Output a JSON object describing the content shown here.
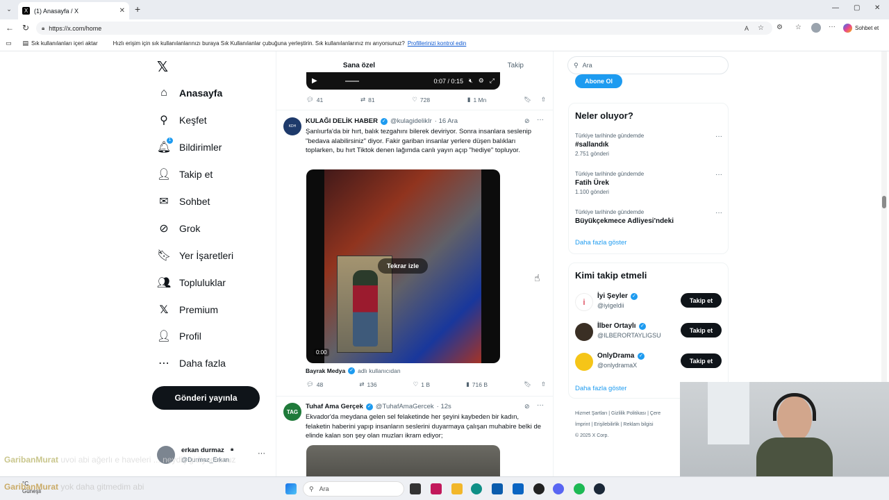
{
  "browser": {
    "tab_title": "(1) Anasayfa / X",
    "url": "https://x.com/home",
    "copilot_label": "Sohbet et",
    "import_label": "Sık kullanılanları içeri aktar",
    "fav_hint": "Hızlı erişim için sık kullanılanlarınızı buraya Sık Kullanılanlar çubuğuna yerleştirin. Sık kullanılanlarınız mı arıyorsunuz?",
    "fav_link": "Profillerinizi kontrol edin"
  },
  "nav": {
    "home": "Anasayfa",
    "explore": "Keşfet",
    "notifications": "Bildirimler",
    "follow": "Takip et",
    "chat": "Sohbet",
    "grok": "Grok",
    "bookmarks": "Yer İşaretleri",
    "communities": "Topluluklar",
    "premium": "Premium",
    "profile": "Profil",
    "more": "Daha fazla",
    "post_button": "Gönderi yayınla",
    "notif_count": "1"
  },
  "account": {
    "name": "erkan durmaz",
    "handle": "@Durmaz_Erkan"
  },
  "feed": {
    "tab_for_you": "Sana özel",
    "tab_following": "Takip",
    "top_video_time": "0:07 / 0:15",
    "top_stats": {
      "replies": "41",
      "reposts": "81",
      "likes": "728",
      "views": "1 Mn"
    },
    "post1": {
      "name": "KULAĞI DELİK HABER",
      "handle": "@kulagidelikIr",
      "time": "· 16 Ara",
      "text": "Şanlıurfa'da bir hırt, balık tezgahını bilerek deviriyor. Sonra insanlara seslenip \"bedava alabilirsiniz\" diyor. Fakir gariban insanlar yerlere düşen balıkları toplarken, bu hırt Tiktok denen lağımda canlı yayın açıp \"hediye\" topluyor.",
      "replay": "Tekrar izle",
      "video_time": "0:00",
      "source_name": "Bayrak Medya",
      "source_suffix": "adlı kullanıcıdan",
      "stats": {
        "replies": "48",
        "reposts": "136",
        "likes": "1 B",
        "views": "716 B"
      }
    },
    "post2": {
      "name": "Tuhaf Ama Gerçek",
      "handle": "@TuhafAmaGercek",
      "time": "· 12s",
      "text": "Ekvador'da meydana gelen sel felaketinde her şeyini kaybeden bir kadın, felaketin haberini yapıp insanların seslerini duyarmaya çalışan muhabire belki de elinde kalan son şey olan muzları ikram ediyor;"
    }
  },
  "sidebar": {
    "search_placeholder": "Ara",
    "subscribe": "Abone Ol",
    "trends_title": "Neler oluyor?",
    "trends": [
      {
        "category": "Türkiye tarihinde gündemde",
        "name": "#sallandık",
        "count": "2.751 gönderi"
      },
      {
        "category": "Türkiye tarihinde gündemde",
        "name": "Fatih Ürek",
        "count": "1.100 gönderi"
      },
      {
        "category": "Türkiye tarihinde gündemde",
        "name": "Büyükçekmece Adliyesi'ndeki",
        "count": ""
      }
    ],
    "show_more": "Daha fazla göster",
    "who_title": "Kimi takip etmeli",
    "who": [
      {
        "name": "İyi Şeyler",
        "handle": "@iyigeldii",
        "btn": "Takip et"
      },
      {
        "name": "İlber Ortaylı",
        "handle": "@ILBERORTAYLIGSU",
        "btn": "Takip et"
      },
      {
        "name": "OnlyDrama",
        "handle": "@onlydramaX",
        "btn": "Takip et"
      }
    ],
    "show_more2": "Daha fazla göster",
    "footer": [
      "Hizmet Şartları",
      "Gizlilik Politikası",
      "Çere",
      "İmprint",
      "Erişilebilirlik",
      "Reklam bilgisi"
    ],
    "copyright": "© 2025 X Corp."
  },
  "overlay": {
    "chat1_user": "GaribanMurat",
    "chat1_text": "uvoi abi ağerlı e haveleri ... neydiç gidiyorsunuz",
    "chat2_user": "GaribanMurat",
    "chat2_text": "yok daha gitmedim abi",
    "weather": "Güneşli",
    "weather_temp": "°C"
  },
  "taskbar": {
    "search": "Ara"
  },
  "colors": {
    "accent": "#1d9bf0",
    "dark": "#0f1419",
    "muted": "#536471"
  }
}
